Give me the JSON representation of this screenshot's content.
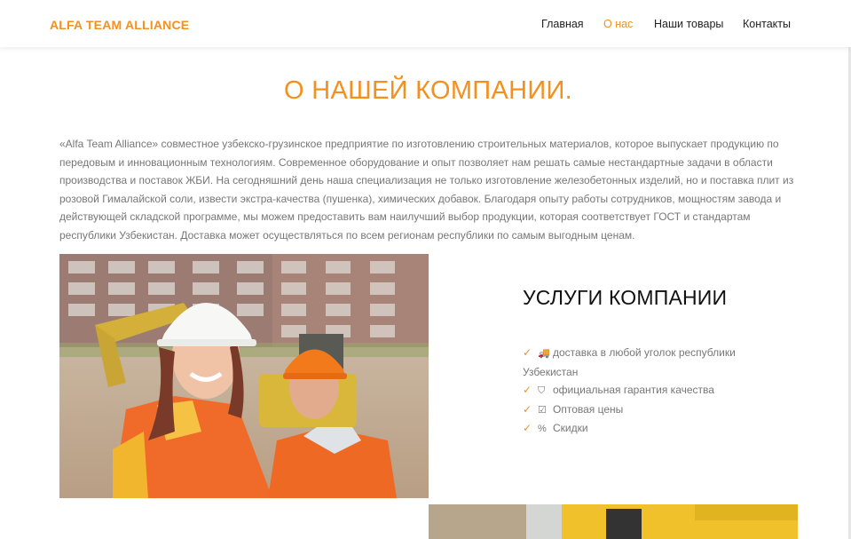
{
  "header": {
    "logo": "ALFA TEAM ALLIANCE",
    "nav": [
      {
        "label": "Главная"
      },
      {
        "label": "О нас"
      },
      {
        "label": "Наши товары"
      },
      {
        "label": "Контакты"
      }
    ],
    "active_nav": "О нас"
  },
  "main": {
    "title": "О НАШЕЙ КОМПАНИИ.",
    "intro": "«Alfa Team Alliance» совместное узбекско-грузинское предприятие по изготовлению строительных материалов, которое выпускает продукцию по передовым и инновационным технологиям. Современное оборудование и опыт позволяет нам решать самые нестандартные задачи в области производства и поставок ЖБИ. На сегодняшний день наша специализация не только изготовление железобетонных изделий, но и поставка плит из розовой Гималайской соли, извести экстра-качества (пушенка), химических добавок. Благодаря опыту работы сотрудников, мощностям завода и действующей складской программе, мы можем предоставить вам наилучший выбор продукции, которая соответствует ГОСТ и стандартам республики Узбекистан. Доставка может осуществляться по всем регионам республики по самым выгодным ценам.",
    "services_title": "УСЛУГИ КОМПАНИИ",
    "services": [
      {
        "icon": "truck-icon",
        "label": "доставка в любой уголок республики Узбекистан"
      },
      {
        "icon": "shield-icon",
        "label": "официальная гарантия качества"
      },
      {
        "icon": "checkbox-icon",
        "label": "Оптовая цены"
      },
      {
        "icon": "percent-icon",
        "label": "Скидки"
      }
    ]
  },
  "colors": {
    "accent": "#f4901e",
    "text": "#777777",
    "heading": "#111111"
  }
}
